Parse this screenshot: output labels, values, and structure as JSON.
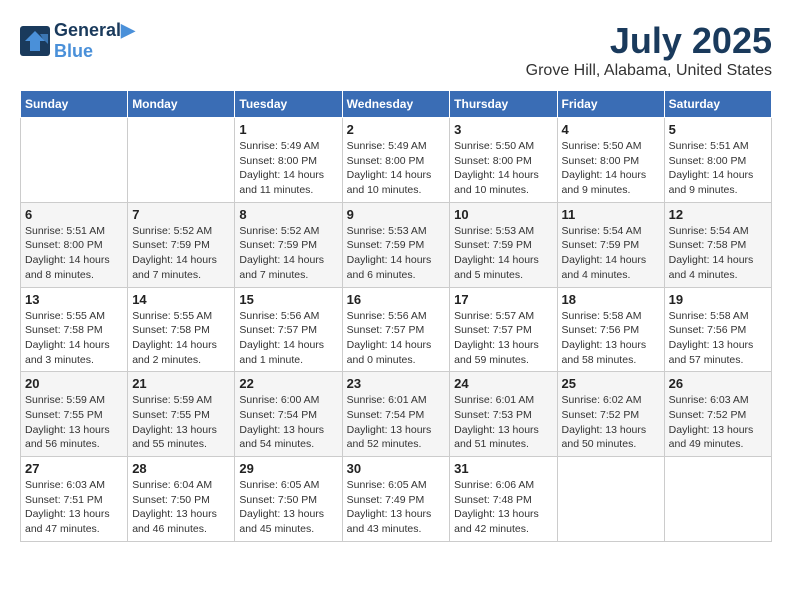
{
  "header": {
    "logo_line1": "General",
    "logo_line2": "Blue",
    "month": "July 2025",
    "location": "Grove Hill, Alabama, United States"
  },
  "weekdays": [
    "Sunday",
    "Monday",
    "Tuesday",
    "Wednesday",
    "Thursday",
    "Friday",
    "Saturday"
  ],
  "weeks": [
    [
      {
        "day": "",
        "sunrise": "",
        "sunset": "",
        "daylight": ""
      },
      {
        "day": "",
        "sunrise": "",
        "sunset": "",
        "daylight": ""
      },
      {
        "day": "1",
        "sunrise": "Sunrise: 5:49 AM",
        "sunset": "Sunset: 8:00 PM",
        "daylight": "Daylight: 14 hours and 11 minutes."
      },
      {
        "day": "2",
        "sunrise": "Sunrise: 5:49 AM",
        "sunset": "Sunset: 8:00 PM",
        "daylight": "Daylight: 14 hours and 10 minutes."
      },
      {
        "day": "3",
        "sunrise": "Sunrise: 5:50 AM",
        "sunset": "Sunset: 8:00 PM",
        "daylight": "Daylight: 14 hours and 10 minutes."
      },
      {
        "day": "4",
        "sunrise": "Sunrise: 5:50 AM",
        "sunset": "Sunset: 8:00 PM",
        "daylight": "Daylight: 14 hours and 9 minutes."
      },
      {
        "day": "5",
        "sunrise": "Sunrise: 5:51 AM",
        "sunset": "Sunset: 8:00 PM",
        "daylight": "Daylight: 14 hours and 9 minutes."
      }
    ],
    [
      {
        "day": "6",
        "sunrise": "Sunrise: 5:51 AM",
        "sunset": "Sunset: 8:00 PM",
        "daylight": "Daylight: 14 hours and 8 minutes."
      },
      {
        "day": "7",
        "sunrise": "Sunrise: 5:52 AM",
        "sunset": "Sunset: 7:59 PM",
        "daylight": "Daylight: 14 hours and 7 minutes."
      },
      {
        "day": "8",
        "sunrise": "Sunrise: 5:52 AM",
        "sunset": "Sunset: 7:59 PM",
        "daylight": "Daylight: 14 hours and 7 minutes."
      },
      {
        "day": "9",
        "sunrise": "Sunrise: 5:53 AM",
        "sunset": "Sunset: 7:59 PM",
        "daylight": "Daylight: 14 hours and 6 minutes."
      },
      {
        "day": "10",
        "sunrise": "Sunrise: 5:53 AM",
        "sunset": "Sunset: 7:59 PM",
        "daylight": "Daylight: 14 hours and 5 minutes."
      },
      {
        "day": "11",
        "sunrise": "Sunrise: 5:54 AM",
        "sunset": "Sunset: 7:59 PM",
        "daylight": "Daylight: 14 hours and 4 minutes."
      },
      {
        "day": "12",
        "sunrise": "Sunrise: 5:54 AM",
        "sunset": "Sunset: 7:58 PM",
        "daylight": "Daylight: 14 hours and 4 minutes."
      }
    ],
    [
      {
        "day": "13",
        "sunrise": "Sunrise: 5:55 AM",
        "sunset": "Sunset: 7:58 PM",
        "daylight": "Daylight: 14 hours and 3 minutes."
      },
      {
        "day": "14",
        "sunrise": "Sunrise: 5:55 AM",
        "sunset": "Sunset: 7:58 PM",
        "daylight": "Daylight: 14 hours and 2 minutes."
      },
      {
        "day": "15",
        "sunrise": "Sunrise: 5:56 AM",
        "sunset": "Sunset: 7:57 PM",
        "daylight": "Daylight: 14 hours and 1 minute."
      },
      {
        "day": "16",
        "sunrise": "Sunrise: 5:56 AM",
        "sunset": "Sunset: 7:57 PM",
        "daylight": "Daylight: 14 hours and 0 minutes."
      },
      {
        "day": "17",
        "sunrise": "Sunrise: 5:57 AM",
        "sunset": "Sunset: 7:57 PM",
        "daylight": "Daylight: 13 hours and 59 minutes."
      },
      {
        "day": "18",
        "sunrise": "Sunrise: 5:58 AM",
        "sunset": "Sunset: 7:56 PM",
        "daylight": "Daylight: 13 hours and 58 minutes."
      },
      {
        "day": "19",
        "sunrise": "Sunrise: 5:58 AM",
        "sunset": "Sunset: 7:56 PM",
        "daylight": "Daylight: 13 hours and 57 minutes."
      }
    ],
    [
      {
        "day": "20",
        "sunrise": "Sunrise: 5:59 AM",
        "sunset": "Sunset: 7:55 PM",
        "daylight": "Daylight: 13 hours and 56 minutes."
      },
      {
        "day": "21",
        "sunrise": "Sunrise: 5:59 AM",
        "sunset": "Sunset: 7:55 PM",
        "daylight": "Daylight: 13 hours and 55 minutes."
      },
      {
        "day": "22",
        "sunrise": "Sunrise: 6:00 AM",
        "sunset": "Sunset: 7:54 PM",
        "daylight": "Daylight: 13 hours and 54 minutes."
      },
      {
        "day": "23",
        "sunrise": "Sunrise: 6:01 AM",
        "sunset": "Sunset: 7:54 PM",
        "daylight": "Daylight: 13 hours and 52 minutes."
      },
      {
        "day": "24",
        "sunrise": "Sunrise: 6:01 AM",
        "sunset": "Sunset: 7:53 PM",
        "daylight": "Daylight: 13 hours and 51 minutes."
      },
      {
        "day": "25",
        "sunrise": "Sunrise: 6:02 AM",
        "sunset": "Sunset: 7:52 PM",
        "daylight": "Daylight: 13 hours and 50 minutes."
      },
      {
        "day": "26",
        "sunrise": "Sunrise: 6:03 AM",
        "sunset": "Sunset: 7:52 PM",
        "daylight": "Daylight: 13 hours and 49 minutes."
      }
    ],
    [
      {
        "day": "27",
        "sunrise": "Sunrise: 6:03 AM",
        "sunset": "Sunset: 7:51 PM",
        "daylight": "Daylight: 13 hours and 47 minutes."
      },
      {
        "day": "28",
        "sunrise": "Sunrise: 6:04 AM",
        "sunset": "Sunset: 7:50 PM",
        "daylight": "Daylight: 13 hours and 46 minutes."
      },
      {
        "day": "29",
        "sunrise": "Sunrise: 6:05 AM",
        "sunset": "Sunset: 7:50 PM",
        "daylight": "Daylight: 13 hours and 45 minutes."
      },
      {
        "day": "30",
        "sunrise": "Sunrise: 6:05 AM",
        "sunset": "Sunset: 7:49 PM",
        "daylight": "Daylight: 13 hours and 43 minutes."
      },
      {
        "day": "31",
        "sunrise": "Sunrise: 6:06 AM",
        "sunset": "Sunset: 7:48 PM",
        "daylight": "Daylight: 13 hours and 42 minutes."
      },
      {
        "day": "",
        "sunrise": "",
        "sunset": "",
        "daylight": ""
      },
      {
        "day": "",
        "sunrise": "",
        "sunset": "",
        "daylight": ""
      }
    ]
  ]
}
